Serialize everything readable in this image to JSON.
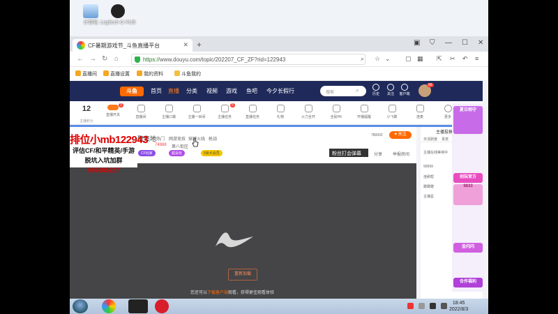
{
  "desktop": {
    "icons": [
      {
        "label": "计算机"
      },
      {
        "label": "Logitech G HUB"
      }
    ]
  },
  "browser": {
    "tab_title": "CF暑期游戏节_斗鱼直播平台",
    "url_scheme": "https://",
    "url_rest": "www.douyu.com/topic/202207_CF_ZF?rid=122943",
    "bookmarks": [
      "直播间",
      "直播设置",
      "我的资料",
      "斗鱼我的"
    ]
  },
  "douyu": {
    "logo": "斗鱼",
    "nav": [
      "首页",
      "直播",
      "分类",
      "视频",
      "游戏",
      "鱼吧",
      "今夕长假行"
    ],
    "search_placeholder": "搜索",
    "header_icons": [
      "历史",
      "关注",
      "客户端",
      "消息"
    ],
    "avatar_badge": "99",
    "level": "12",
    "level_label": "主播积分",
    "toolbar_items": [
      "直播开关",
      "直播间",
      "主播口袋",
      "主播一目间",
      "主播任务",
      "直播任务",
      "礼物",
      "火力全开",
      "全民PK",
      "开播提醒",
      "小飞碟",
      "连麦",
      "更多"
    ],
    "toolbar_badges": [
      "3",
      "5"
    ],
    "room": {
      "title_suffix": "聚集地",
      "meta": [
        "热门",
        "网游竞技",
        "穿越火线",
        "枪战",
        "74988",
        "第八街区"
      ],
      "pills": [
        "CF玩家",
        "超会玩",
        "5级大会员"
      ],
      "follow": "关注",
      "fans_count": "780002",
      "gift_button": "粉丝打会弹幕",
      "share": "分享",
      "report": "举报房间"
    },
    "player": {
      "reload": "重新加载",
      "tip_prefix": "您还可以",
      "tip_link": "下载客户端",
      "tip_suffix": "观看，获得更佳观看体验"
    },
    "overlay": {
      "line1": "排位小mb122943",
      "line2": "评估CF/和平精英/手游",
      "line3_prefix": "脱坑入坑加群",
      "line3_number": "597685227"
    },
    "right_panel": {
      "title": "主播投稿",
      "tabs": [
        "日活跃度",
        "贵宾"
      ],
      "lines": [
        "主播在线等待中",
        "99999",
        "连刷帮",
        "蹲蹲蹲",
        "主播星"
      ]
    },
    "promo": [
      "夏日相守",
      "创玩官方",
      "9833",
      "金闪闪",
      "合作福利"
    ]
  },
  "taskbar": {
    "time": "18:45",
    "date": "2022/8/3"
  },
  "colors": {
    "accent": "#ff6a00",
    "header": "#1f2a5a",
    "overlay_red": "#e00000"
  }
}
